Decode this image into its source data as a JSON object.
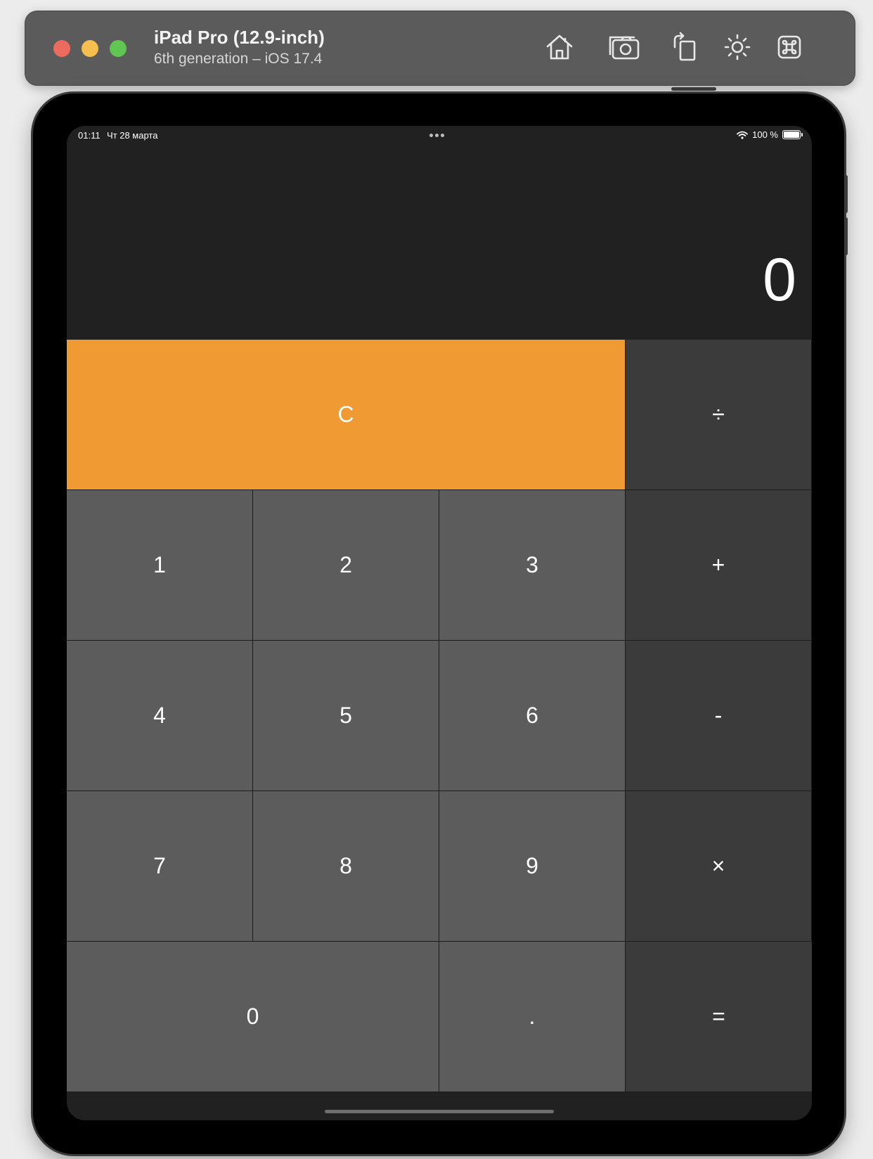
{
  "simulator": {
    "device_name": "iPad Pro (12.9-inch)",
    "device_subtitle": "6th generation – iOS 17.4",
    "toolbar_icons": [
      "home-icon",
      "screenshot-camera-icon",
      "rotate-icon",
      "brightness-icon",
      "command-key-icon"
    ]
  },
  "status_bar": {
    "time": "01:11",
    "date": "Чт 28 марта",
    "battery_text": "100 %"
  },
  "calculator": {
    "display_value": "0",
    "keys": {
      "clear": "C",
      "divide": "÷",
      "one": "1",
      "two": "2",
      "three": "3",
      "plus": "+",
      "four": "4",
      "five": "5",
      "six": "6",
      "minus": "-",
      "seven": "7",
      "eight": "8",
      "nine": "9",
      "multiply": "×",
      "zero": "0",
      "decimal": ".",
      "equals": "="
    },
    "colors": {
      "clear_key": "#ef9a33",
      "number_key": "#5c5c5c",
      "operator_key": "#3b3b3b",
      "background": "#212121"
    }
  }
}
